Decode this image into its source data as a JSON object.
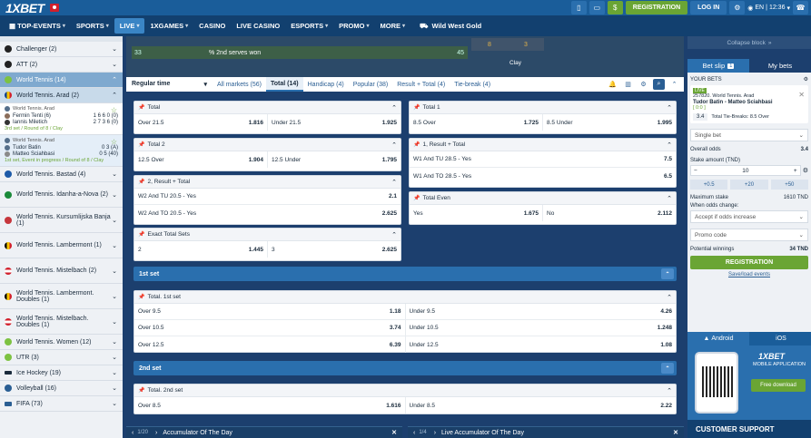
{
  "header": {
    "logo": "1XBET",
    "registration": "REGISTRATION",
    "login": "LOG IN",
    "lang": "EN",
    "time": "12:36",
    "dollar": "$"
  },
  "nav": {
    "items": [
      "TOP-EVENTS",
      "SPORTS",
      "LIVE",
      "1XGAMES",
      "CASINO",
      "LIVE CASINO",
      "ESPORTS",
      "PROMO",
      "MORE"
    ],
    "featured": "Wild West Gold"
  },
  "sidebar": {
    "top": [
      {
        "label": "Challenger (2)"
      },
      {
        "label": "ATT (2)"
      },
      {
        "label": "World Tennis (14)"
      },
      {
        "label": "World Tennis. Arad (2)"
      }
    ],
    "match1": {
      "league": "World Tennis. Arad",
      "p1": "Fermin Tenti (6)",
      "p1score": "1 6 6 0 (0)",
      "p2": "Iannis Miletich",
      "p2score": "2 7 3 6 (0)",
      "status": "3rd set / Round of 8 / Clay"
    },
    "match2": {
      "league": "World Tennis. Arad",
      "p1": "Tudor Batin",
      "p1score": "0 3 (A)",
      "p2": "Matteo Sciahbasi",
      "p2score": "0 5 (40)",
      "status": "1st set, Event in progress / Round of 8 / Clay"
    },
    "bottom": [
      {
        "label": "World Tennis. Bastad (4)"
      },
      {
        "label": "World Tennis. Idanha-a-Nova (2)"
      },
      {
        "label": "World Tennis. Kursumlijska Banja (1)"
      },
      {
        "label": "World Tennis. Lambermont (1)"
      },
      {
        "label": "World Tennis. Mistelbach (2)"
      },
      {
        "label": "World Tennis. Lambermont. Doubles (1)"
      },
      {
        "label": "World Tennis. Mistelbach. Doubles (1)"
      },
      {
        "label": "World Tennis. Women (12)"
      },
      {
        "label": "UTR (3)"
      },
      {
        "label": "Ice Hockey (19)"
      },
      {
        "label": "Volleyball (16)"
      },
      {
        "label": "FIFA (73)"
      }
    ]
  },
  "scoreboard": {
    "left": "33",
    "stat": "% 2nd serves won",
    "right": "45",
    "surface": "Clay",
    "g1": "8",
    "g2": "3"
  },
  "tabs": {
    "time": "Regular time",
    "items": [
      "All markets (56)",
      "Total (14)",
      "Handicap (4)",
      "Popular (38)",
      "Result + Total (4)",
      "Tie-break (4)"
    ]
  },
  "markets": {
    "total": {
      "title": "Total",
      "a": "Over 21.5",
      "av": "1.816",
      "b": "Under 21.5",
      "bv": "1.925"
    },
    "total1": {
      "title": "Total 1",
      "a": "8.5 Over",
      "av": "1.725",
      "b": "8.5 Under",
      "bv": "1.995"
    },
    "total2": {
      "title": "Total 2",
      "a": "12.5 Over",
      "av": "1.904",
      "b": "12.5 Under",
      "bv": "1.795"
    },
    "r1": {
      "title": "1, Result + Total",
      "a": "W1 And TU 28.5 - Yes",
      "av": "7.5",
      "b": "W1 And TO 28.5 - Yes",
      "bv": "6.5"
    },
    "r2": {
      "title": "2, Result + Total",
      "a": "W2 And TU 20.5 - Yes",
      "av": "2.1",
      "b": "W2 And TO 20.5 - Yes",
      "bv": "2.625"
    },
    "even": {
      "title": "Total Even",
      "a": "Yes",
      "av": "1.675",
      "b": "No",
      "bv": "2.112"
    },
    "exact": {
      "title": "Exact Total Sets",
      "a": "2",
      "av": "1.445",
      "b": "3",
      "bv": "2.625"
    },
    "set1": {
      "section": "1st set",
      "title": "Total. 1st set",
      "rows": [
        {
          "a": "Over 9.5",
          "av": "1.18",
          "b": "Under 9.5",
          "bv": "4.26"
        },
        {
          "a": "Over 10.5",
          "av": "3.74",
          "b": "Under 10.5",
          "bv": "1.248"
        },
        {
          "a": "Over 12.5",
          "av": "6.39",
          "b": "Under 12.5",
          "bv": "1.08"
        }
      ]
    },
    "set2": {
      "section": "2nd set",
      "title": "Total. 2nd set",
      "rows": [
        {
          "a": "Over 8.5",
          "av": "1.616",
          "b": "Under 8.5",
          "bv": "2.22"
        }
      ]
    }
  },
  "bottom": {
    "acc1num": "1/20",
    "acc1": "Accumulator Of The Day",
    "acc2num": "1/4",
    "acc2": "Live Accumulator Of The Day"
  },
  "slip": {
    "collapse": "Collapse block",
    "tab1": "Bet slip",
    "badge": "1",
    "tab2": "My bets",
    "yourbets": "YOUR BETS",
    "live": "LIVE",
    "event": "257820. World Tennis. Arad",
    "teams": "Tudor Batin - Matteo Sciahbasi",
    "score": "[ 0:0 ]",
    "odd": "3.4",
    "market": "Total Tie-Breaks: 8.5 Over",
    "single": "Single bet",
    "overall_label": "Overall odds",
    "overall": "3.4",
    "stake_label": "Stake amount (TND)",
    "stake": "10",
    "q1": "+0.5",
    "q2": "+20",
    "q3": "+50",
    "max_label": "Maximum stake",
    "max": "1610 TND",
    "when": "When odds change:",
    "accept": "Accept if odds increase",
    "promo": "Promo code",
    "winnings_label": "Potential winnings",
    "winnings": "34 TND",
    "register": "REGISTRATION",
    "saveload": "Save/load events"
  },
  "apps": {
    "android": "Android",
    "ios": "iOS",
    "logo": "1XBET",
    "mobile": "MOBILE APPLICATION",
    "download": "Free download"
  },
  "support": "CUSTOMER SUPPORT"
}
